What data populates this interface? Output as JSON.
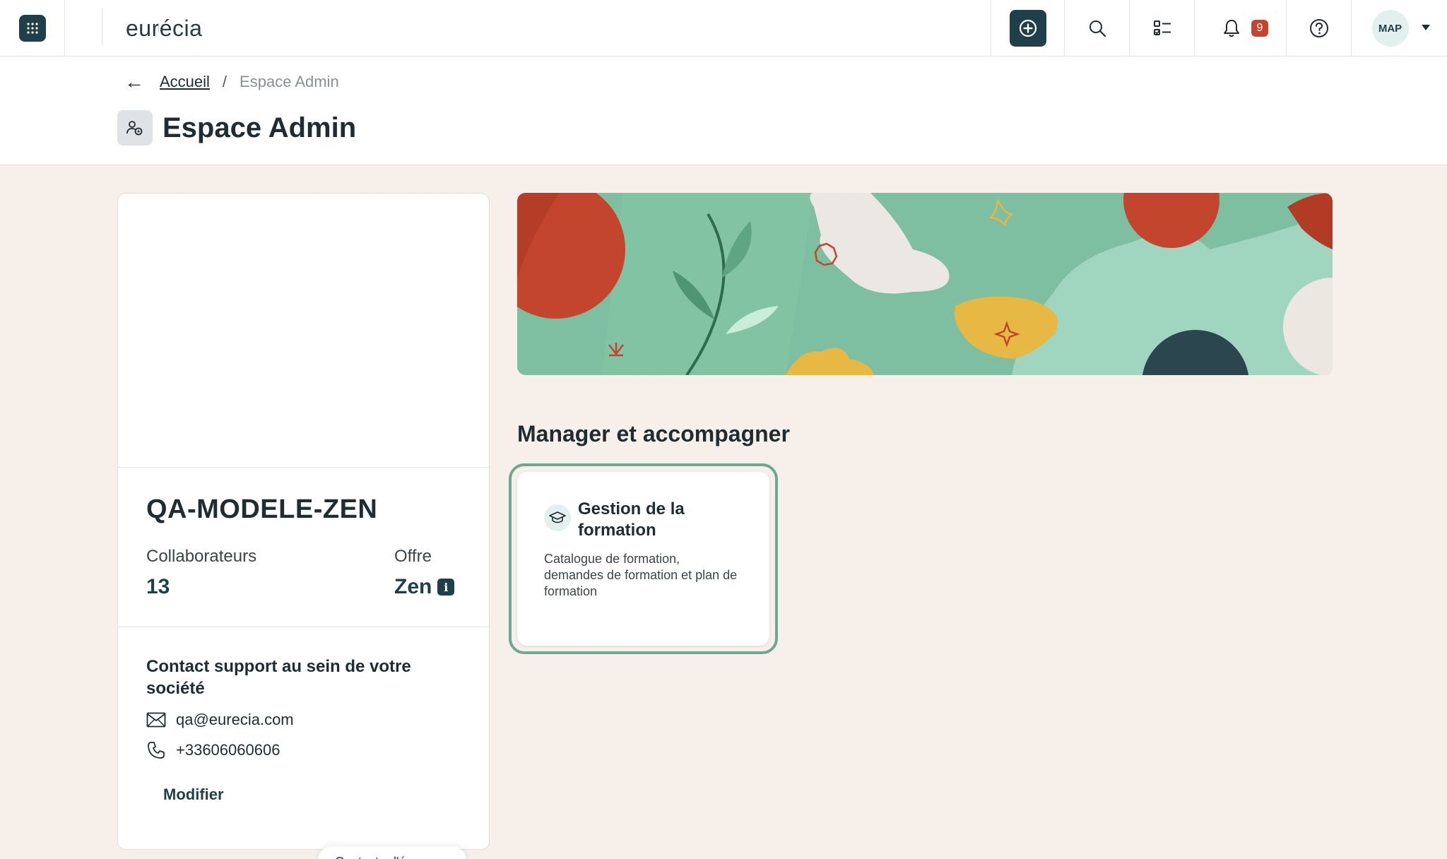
{
  "app": {
    "logo_text": "eurécia"
  },
  "nav": {
    "notifications_count": "9",
    "user_initials": "MAP",
    "icons": [
      "apps-grid-icon",
      "plus-circle-icon",
      "search-icon",
      "checklist-icon",
      "bell-icon",
      "help-icon"
    ]
  },
  "breadcrumb": {
    "back": "←",
    "home": "Accueil",
    "separator": "/",
    "current": "Espace Admin"
  },
  "page": {
    "title": "Espace Admin"
  },
  "company": {
    "name": "QA-MODELE-ZEN",
    "collaborators_label": "Collaborateurs",
    "collaborators_value": "13",
    "offer_label": "Offre",
    "offer_value": "Zen",
    "info_glyph": "i"
  },
  "contact": {
    "title": "Contact support au sein de votre société",
    "email": "qa@eurecia.com",
    "phone": "+33606060606",
    "modify_label": "Modifier"
  },
  "floating_pill": {
    "label": "Contacter l'é..."
  },
  "section": {
    "title": "Manager et accompagner"
  },
  "modules": [
    {
      "title": "Gestion de la formation",
      "description": "Catalogue de formation, demandes de formation et plan de formation",
      "icon": "graduation-cap-icon"
    }
  ],
  "colors": {
    "brand_dark": "#1f3f4a",
    "badge_red": "#c4452d",
    "page_bg": "#f7f0ea",
    "card_border_focus": "#6fa795",
    "banner_green": "#7dbfa0"
  }
}
